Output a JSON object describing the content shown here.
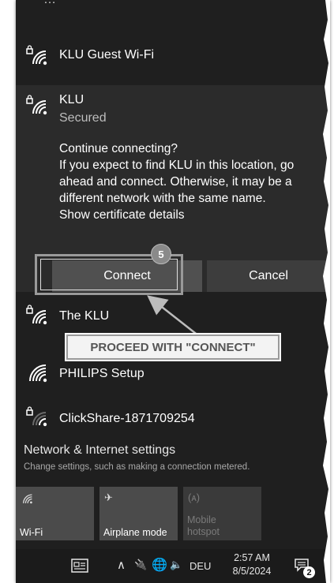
{
  "networks": {
    "partial_top_label": "…",
    "guest": {
      "name": "KLU Guest Wi-Fi"
    },
    "klu": {
      "name": "KLU",
      "status": "Secured",
      "prompt_lines": [
        "Continue connecting?",
        "If you expect to find KLU in this location, go",
        "ahead and connect. Otherwise, it may be a",
        "different network with the same name.",
        "Show certificate details"
      ],
      "connect_label": "Connect",
      "cancel_label": "Cancel"
    },
    "the_klu": {
      "name": "The KLU"
    },
    "philips": {
      "name": "PHILIPS Setup"
    },
    "clickshare": {
      "name": "ClickShare-1871709254"
    }
  },
  "annotation": {
    "step_number": "5",
    "callout_text": "PROCEED WITH \"CONNECT\""
  },
  "settings": {
    "title": "Network & Internet settings",
    "subtitle": "Change settings, such as making a connection metered."
  },
  "quick_actions": [
    {
      "label": "Wi-Fi",
      "icon": "wifi-icon",
      "state": "on"
    },
    {
      "label": "Airplane mode",
      "icon": "airplane-icon",
      "state": "off"
    },
    {
      "label": "Mobile hotspot",
      "label_line1": "Mobile",
      "label_line2": "hotspot",
      "icon": "hotspot-icon",
      "state": "disabled"
    }
  ],
  "taskbar": {
    "language": "DEU",
    "time": "2:57 AM",
    "date": "8/5/2024",
    "notification_count": "2"
  },
  "colors": {
    "panel_bg": "#1f1f1f",
    "expanded_bg": "#2b2b2b",
    "connect_bg": "#505050",
    "tile_bg": "#4b4b4b"
  }
}
